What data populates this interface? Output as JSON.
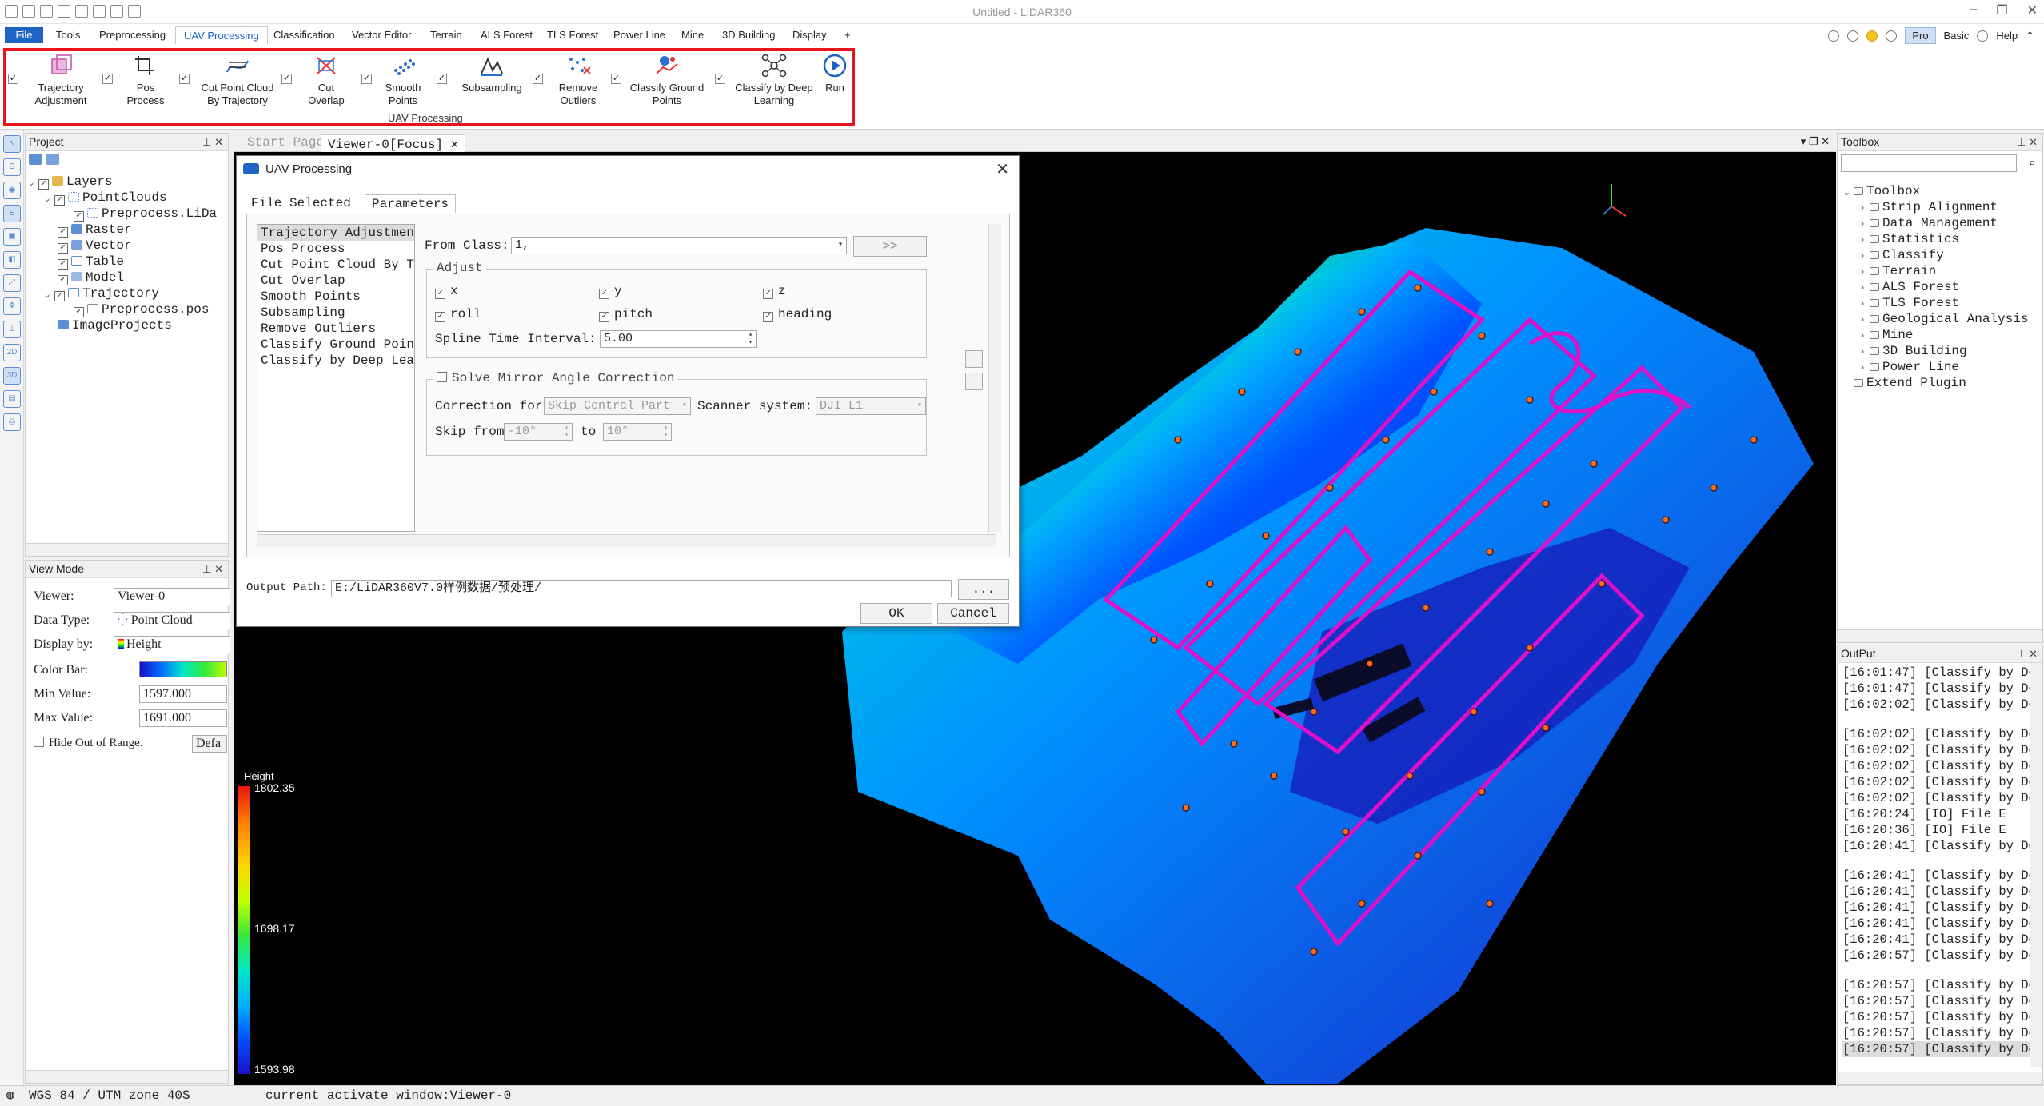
{
  "window": {
    "title": "Untitled - LiDAR360"
  },
  "menu": {
    "tabs": [
      "File",
      "Tools",
      "Preprocessing",
      "UAV Processing",
      "Classification",
      "Vector Editor",
      "Terrain",
      "ALS Forest",
      "TLS Forest",
      "Power Line",
      "Mine",
      "3D Building",
      "Display",
      "+"
    ],
    "right": {
      "pro": "Pro",
      "basic": "Basic",
      "help": "Help"
    }
  },
  "ribbon": {
    "group_label": "UAV Processing",
    "tools": [
      {
        "l1": "Trajectory",
        "l2": "Adjustment"
      },
      {
        "l1": "Pos",
        "l2": "Process"
      },
      {
        "l1": "Cut Point Cloud",
        "l2": "By Trajectory"
      },
      {
        "l1": "Cut",
        "l2": "Overlap"
      },
      {
        "l1": "Smooth",
        "l2": "Points"
      },
      {
        "l1": "Subsampling",
        "l2": ""
      },
      {
        "l1": "Remove",
        "l2": "Outliers"
      },
      {
        "l1": "Classify Ground",
        "l2": "Points"
      },
      {
        "l1": "Classify by Deep",
        "l2": "Learning"
      },
      {
        "l1": "Run",
        "l2": ""
      }
    ]
  },
  "project": {
    "title": "Project",
    "tree": [
      "Layers",
      "PointClouds",
      "Preprocess.LiDa",
      "Raster",
      "Vector",
      "Table",
      "Model",
      "Trajectory",
      "Preprocess.pos",
      "ImageProjects"
    ]
  },
  "viewmode": {
    "title": "View Mode",
    "viewer_label": "Viewer:",
    "viewer_value": "Viewer-0",
    "datatype_label": "Data Type:",
    "datatype_value": "Point Cloud",
    "display_label": "Display by:",
    "display_value": "Height",
    "colorbar_label": "Color Bar:",
    "min_label": "Min Value:",
    "min_value": "1597.000",
    "max_label": "Max Value:",
    "max_value": "1691.000",
    "hide_label": "Hide Out of Range.",
    "default_btn": "Defa"
  },
  "viewer": {
    "tabs": {
      "start": "Start Page",
      "active": "Viewer-0[Focus]"
    },
    "colorbar": {
      "title": "Height",
      "max": "1802.35",
      "mid": "1698.17",
      "min": "1593.98"
    }
  },
  "dialog": {
    "title": "UAV Processing",
    "tab_file": "File Selected",
    "tab_params": "Parameters",
    "steps": [
      "Trajectory Adjustment",
      "Pos Process",
      "Cut Point Cloud By Tra",
      "Cut Overlap",
      "Smooth Points",
      "Subsampling",
      "Remove Outliers",
      "Classify Ground Points",
      "Classify by Deep Learn"
    ],
    "from_class_label": "From Class:",
    "from_class_value": "1,",
    "from_class_btn": ">>",
    "adjust_label": "Adjust",
    "adjust": [
      "x",
      "y",
      "z",
      "roll",
      "pitch",
      "heading"
    ],
    "spline_label": "Spline Time Interval:",
    "spline_value": "5.00",
    "mirror_label": "Solve Mirror Angle Correction",
    "correction_label": "Correction for",
    "correction_value": "Skip Central Part",
    "scanner_label": "Scanner system:",
    "scanner_value": "DJI L1",
    "skip_from_label": "Skip from",
    "skip_from_value": "-10°",
    "to_label": "to",
    "to_value": "10°",
    "output_label": "Output Path:",
    "output_value": "E:/LiDAR360V7.0样例数据/预处理/",
    "browse": "...",
    "ok": "OK",
    "cancel": "Cancel"
  },
  "toolbox": {
    "title": "Toolbox",
    "root": "Toolbox",
    "items": [
      "Strip Alignment",
      "Data Management",
      "Statistics",
      "Classify",
      "Terrain",
      "ALS Forest",
      "TLS Forest",
      "Geological Analysis",
      "Mine",
      "3D Building",
      "Power Line"
    ],
    "extend": "Extend Plugin"
  },
  "output": {
    "title": "OutPut",
    "lines": [
      "[16:01:47] [Classify by De",
      "[16:01:47] [Classify by De",
      "[16:02:02] [Classify by De",
      "",
      "[16:02:02] [Classify by De",
      "[16:02:02] [Classify by De",
      "[16:02:02] [Classify by De",
      "[16:02:02] [Classify by De",
      "[16:02:02] [Classify by De",
      "[16:20:24] [IO]    File E",
      "[16:20:36] [IO]    File E",
      "[16:20:41] [Classify by De",
      "",
      "[16:20:41] [Classify by De",
      "[16:20:41] [Classify by De",
      "[16:20:41] [Classify by De",
      "[16:20:41] [Classify by De",
      "[16:20:41] [Classify by De",
      "[16:20:57] [Classify by De",
      "",
      "[16:20:57] [Classify by De",
      "[16:20:57] [Classify by De",
      "[16:20:57] [Classify by De",
      "[16:20:57] [Classify by De",
      "[16:20:57] [Classify by De"
    ]
  },
  "status": {
    "crs": "WGS 84 / UTM zone 40S",
    "message": "current activate window:Viewer-0"
  },
  "colors": {
    "accent": "#1e63c6",
    "highlight": "#e8141c",
    "trajectory": "#e010c8"
  }
}
